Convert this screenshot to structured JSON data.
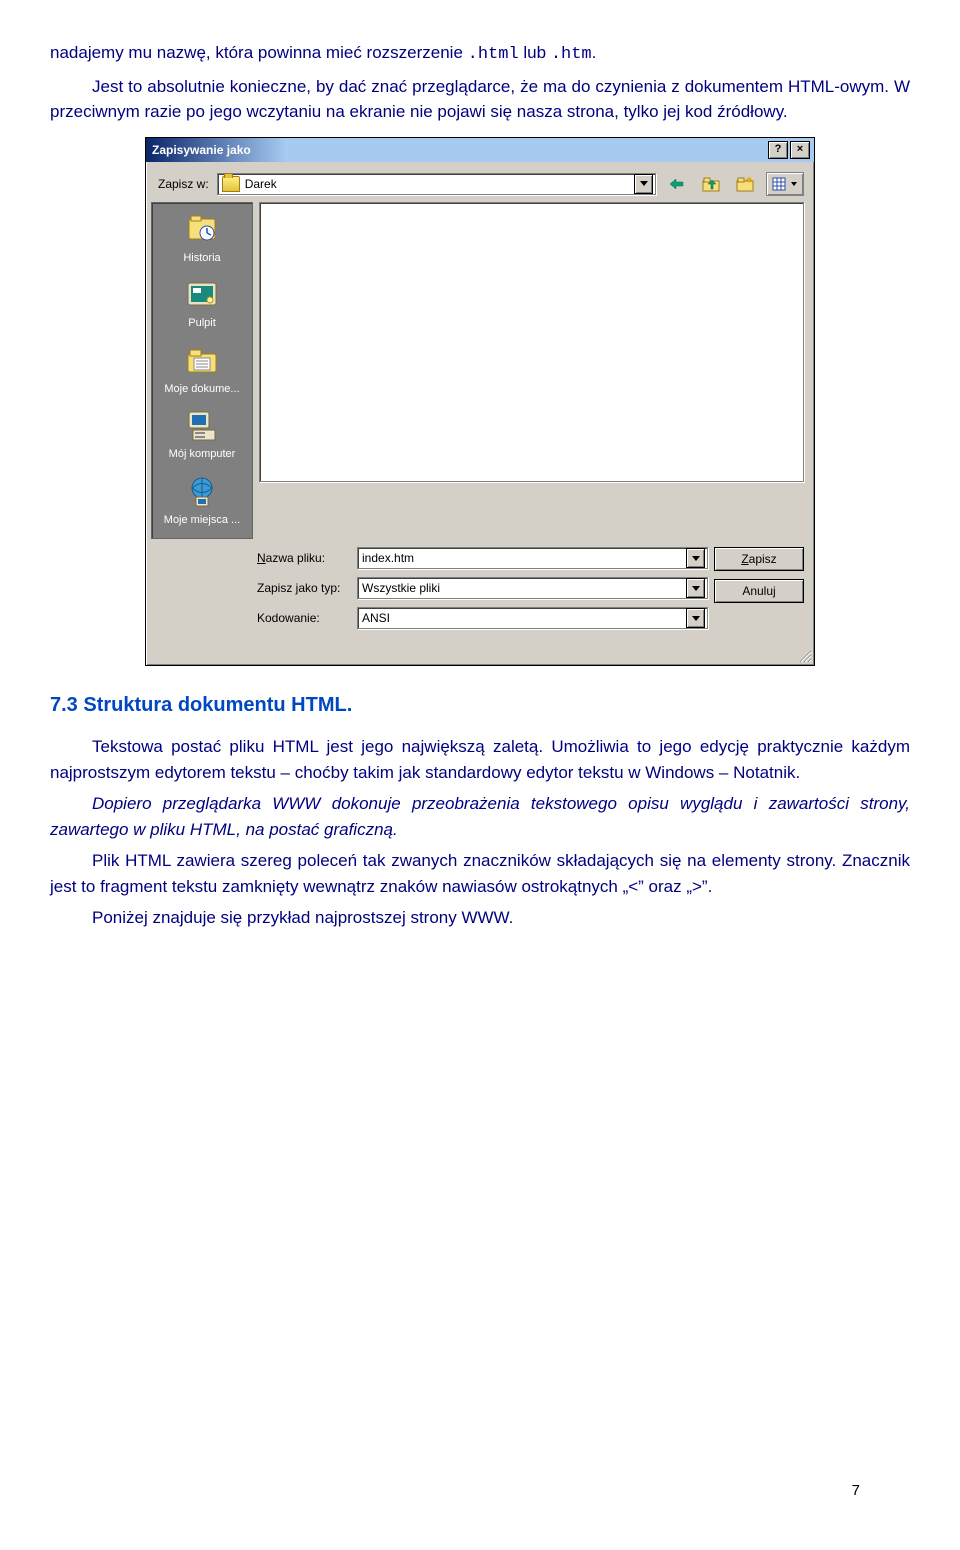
{
  "paragraphs": {
    "p1_a": "nadajemy mu nazwę, która powinna mieć rozszerzenie",
    "p1_ext1": ".html",
    "p1_mid": " lub",
    "p1_ext2": ".htm",
    "p1_end": ".",
    "p2": "Jest to absolutnie konieczne, by dać znać przeglądarce, że ma do czynienia z dokumentem HTML-owym. W przeciwnym razie po jego wczytaniu na ekranie nie pojawi się nasza strona, tylko jej kod źródłowy.",
    "p_heading": "7.3 Struktura dokumentu HTML.",
    "p3": "Tekstowa postać pliku HTML jest jego największą zaletą. Umożliwia to jego edycję praktycznie każdym najprostszym edytorem tekstu – choćby takim jak standardowy edytor tekstu w Windows – Notatnik.",
    "p4": "Dopiero przeglądarka WWW dokonuje przeobrażenia tekstowego opisu wyglądu i zawartości strony, zawartego w pliku HTML, na postać graficzną.",
    "p5": "Plik HTML zawiera szereg poleceń tak zwanych znaczników składających się na elementy strony. Znacznik jest to fragment tekstu zamknięty wewnątrz znaków nawiasów ostrokątnych „<” oraz „>”.",
    "p6": "Poniżej znajduje się przykład najprostszej strony WWW."
  },
  "dialog": {
    "title": "Zapisywanie jako",
    "help": "?",
    "close": "×",
    "savein_label": "Zapisz w:",
    "savein_value": "Darek",
    "places": {
      "history": "Historia",
      "desktop": "Pulpit",
      "mydocs": "Moje dokume...",
      "mycomp": "Mój komputer",
      "myplaces": "Moje miejsca ..."
    },
    "filename_label": "Nazwa pliku:",
    "filename_value": "index.htm",
    "filetype_label": "Zapisz jako typ:",
    "filetype_value": "Wszystkie pliki",
    "encoding_label": "Kodowanie:",
    "encoding_value": "ANSI",
    "btn_save_u": "Z",
    "btn_save_rest": "apisz",
    "btn_cancel": "Anuluj"
  },
  "page_number": "7"
}
